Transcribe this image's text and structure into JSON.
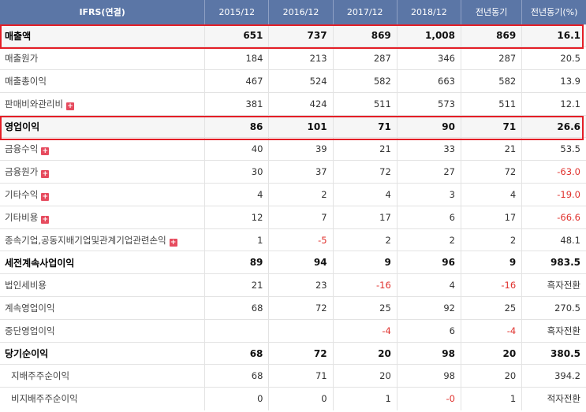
{
  "header": {
    "label": "IFRS(연결)",
    "years": [
      "2015/12",
      "2016/12",
      "2017/12",
      "2018/12"
    ],
    "prev": "전년동기",
    "pct": "전년동기(%)"
  },
  "rows": [
    {
      "label": "매출액",
      "major": true,
      "values": [
        "651",
        "737",
        "869",
        "1,008",
        "869",
        "16.1"
      ]
    },
    {
      "label": "매출원가",
      "values": [
        "184",
        "213",
        "287",
        "346",
        "287",
        "20.5"
      ]
    },
    {
      "label": "매출총이익",
      "values": [
        "467",
        "524",
        "582",
        "663",
        "582",
        "13.9"
      ]
    },
    {
      "label": "판매비와관리비",
      "expand": true,
      "values": [
        "381",
        "424",
        "511",
        "573",
        "511",
        "12.1"
      ]
    },
    {
      "label": "영업이익",
      "major": true,
      "values": [
        "86",
        "101",
        "71",
        "90",
        "71",
        "26.6"
      ]
    },
    {
      "label": "금융수익",
      "expand": true,
      "values": [
        "40",
        "39",
        "21",
        "33",
        "21",
        "53.5"
      ]
    },
    {
      "label": "금융원가",
      "expand": true,
      "values": [
        "30",
        "37",
        "72",
        "27",
        "72",
        "-63.0"
      ]
    },
    {
      "label": "기타수익",
      "expand": true,
      "values": [
        "4",
        "2",
        "4",
        "3",
        "4",
        "-19.0"
      ]
    },
    {
      "label": "기타비용",
      "expand": true,
      "values": [
        "12",
        "7",
        "17",
        "6",
        "17",
        "-66.6"
      ]
    },
    {
      "label": "종속기업,공동지배기업및관계기업관련손익",
      "expand": true,
      "values": [
        "1",
        "-5",
        "2",
        "2",
        "2",
        "48.1"
      ]
    },
    {
      "label": "세전계속사업이익",
      "major": true,
      "values": [
        "89",
        "94",
        "9",
        "96",
        "9",
        "983.5"
      ]
    },
    {
      "label": "법인세비용",
      "values": [
        "21",
        "23",
        "-16",
        "4",
        "-16",
        "흑자전환"
      ]
    },
    {
      "label": "계속영업이익",
      "values": [
        "68",
        "72",
        "25",
        "92",
        "25",
        "270.5"
      ]
    },
    {
      "label": "중단영업이익",
      "values": [
        "",
        "",
        "-4",
        "6",
        "-4",
        "흑자전환"
      ]
    },
    {
      "label": "당기순이익",
      "major": true,
      "values": [
        "68",
        "72",
        "20",
        "98",
        "20",
        "380.5"
      ]
    },
    {
      "label": "지배주주순이익",
      "sub": true,
      "values": [
        "68",
        "71",
        "20",
        "98",
        "20",
        "394.2"
      ]
    },
    {
      "label": "비지배주주순이익",
      "sub": true,
      "values": [
        "0",
        "0",
        "1",
        "-0",
        "1",
        "적자전환"
      ]
    }
  ],
  "colors": {
    "header_bg": "#5b76a6",
    "negative": "#e0322e",
    "highlight_box": "#e41e26",
    "expand_icon": "#e64b5e"
  },
  "icons": {
    "expand": "plus-square-icon"
  }
}
